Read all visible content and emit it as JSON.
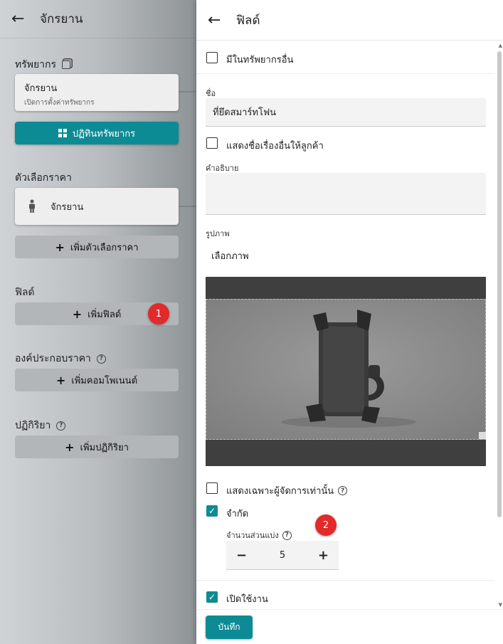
{
  "left": {
    "title": "จักรยาน",
    "resources_title": "ทรัพยากร",
    "resource_card": {
      "name": "จักรยาน",
      "sub": "เปิดการตั้งค่าทรัพยากร"
    },
    "calendar_button": "ปฏิทินทรัพยากร",
    "price_options_title": "ตัวเลือกราคา",
    "price_option_card": "จักรยาน",
    "add_price_option": "เพิ่มตัวเลือกราคา",
    "fields_title": "ฟิลด์",
    "add_field": "เพิ่มฟิลด์",
    "price_components_title": "องค์ประกอบราคา",
    "add_component": "เพิ่มคอมโพเนนต์",
    "actions_title": "ปฏิกิริยา",
    "add_action": "เพิ่มปฏิกิริยา"
  },
  "badges": {
    "one": "1",
    "two": "2"
  },
  "drawer": {
    "title": "ฟิลด์",
    "other_resources_label": "มีในทรัพยากรอื่น",
    "name_label": "ชื่อ",
    "name_value": "ที่ยึดสมาร์ทโฟน",
    "show_other_name_label": "แสดงชื่อเรื่องอื่นให้ลูกค้า",
    "description_label": "คำอธิบาย",
    "description_value": "",
    "image_label": "รูปภาพ",
    "choose_image": "เลือกภาพ",
    "admin_only_label": "แสดงเฉพาะผู้จัดการเท่านั้น",
    "limited_label": "จำกัด",
    "parts_label": "จำนวนส่วนแบ่ง",
    "parts_value": "5",
    "enabled_label": "เปิดใช้งาน",
    "save_button": "บันทึก"
  },
  "checks": {
    "other_resources": false,
    "show_other_name": false,
    "admin_only": false,
    "limited": true,
    "enabled": true
  },
  "colors": {
    "accent": "#0d8b95",
    "badge": "#e32a2a"
  },
  "icons": [
    "back-arrow-icon",
    "copy-icon",
    "calendar-grid-icon",
    "person-icon",
    "plus-icon",
    "help-icon",
    "check-icon",
    "minus-icon"
  ]
}
